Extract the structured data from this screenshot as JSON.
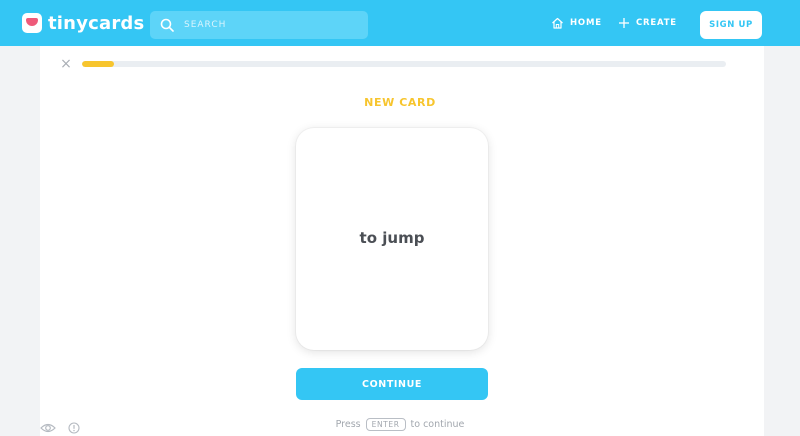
{
  "header": {
    "logo_text": "tinycards",
    "search_placeholder": "SEARCH",
    "nav": {
      "home_label": "HOME",
      "create_label": "CREATE"
    },
    "signup_label": "SIGN UP"
  },
  "lesson": {
    "progress_fraction": 0.05,
    "card_type_label": "NEW CARD",
    "card_text": "to jump",
    "continue_label": "CONTINUE",
    "hint_prefix": "Press",
    "hint_key": "ENTER",
    "hint_suffix": "to continue"
  },
  "icons": {
    "logo": "tinycards-logo-icon",
    "search": "search-icon",
    "home": "home-icon",
    "create": "plus-icon",
    "close": "close-icon",
    "visibility": "eye-icon",
    "info": "info-icon"
  },
  "colors": {
    "brand_blue": "#34c6f4",
    "accent_yellow": "#f7c52e",
    "card_text": "#4b4f55"
  }
}
